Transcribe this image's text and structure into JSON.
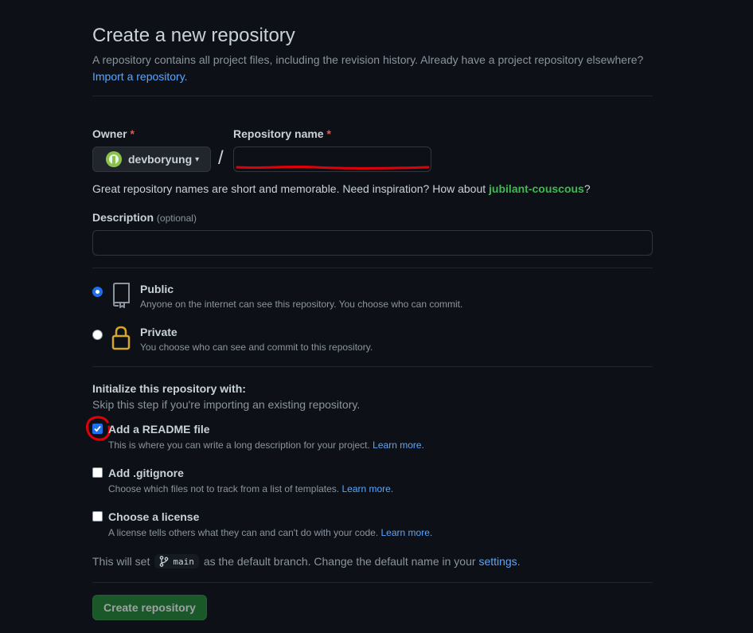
{
  "header": {
    "title": "Create a new repository",
    "subtitle": "A repository contains all project files, including the revision history. Already have a project repository elsewhere?",
    "import_link": "Import a repository."
  },
  "owner": {
    "label": "Owner",
    "required_mark": "*",
    "value": "devboryung",
    "caret": "▾"
  },
  "separator": "/",
  "repo_name": {
    "label": "Repository name",
    "required_mark": "*",
    "value": ""
  },
  "hint": {
    "text": "Great repository names are short and memorable. Need inspiration? How about ",
    "suggestion": "jubilant-couscous",
    "end": "?"
  },
  "description": {
    "label": "Description",
    "optional": "(optional)",
    "value": ""
  },
  "visibility": {
    "public": {
      "title": "Public",
      "desc": "Anyone on the internet can see this repository. You choose who can commit.",
      "selected": true
    },
    "private": {
      "title": "Private",
      "desc": "You choose who can see and commit to this repository.",
      "selected": false
    }
  },
  "init": {
    "title": "Initialize this repository with:",
    "subtitle": "Skip this step if you're importing an existing repository.",
    "readme": {
      "title": "Add a README file",
      "desc": "This is where you can write a long description for your project.",
      "link": "Learn more.",
      "checked": true
    },
    "gitignore": {
      "title": "Add .gitignore",
      "desc": "Choose which files not to track from a list of templates.",
      "link": "Learn more.",
      "checked": false
    },
    "license": {
      "title": "Choose a license",
      "desc": "A license tells others what they can and can't do with your code.",
      "link": "Learn more.",
      "checked": false
    }
  },
  "branch": {
    "prefix": "This will set",
    "name": "main",
    "middle": "as the default branch. Change the default name in your",
    "link": "settings",
    "end": "."
  },
  "submit": {
    "label": "Create repository"
  },
  "colors": {
    "accent": "#58a6ff",
    "success": "#238636",
    "annotation": "#e0000a"
  }
}
